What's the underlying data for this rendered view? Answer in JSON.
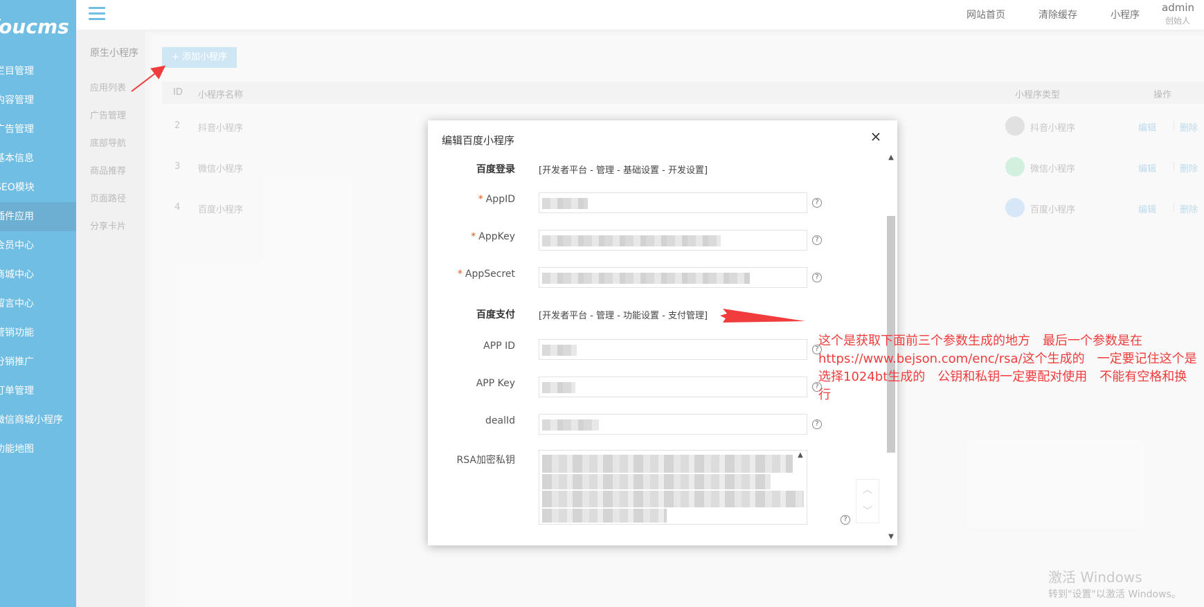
{
  "brand": {
    "logo_text": "foucms"
  },
  "sidebar": {
    "items": [
      {
        "label": "栏目管理"
      },
      {
        "label": "内容管理"
      },
      {
        "label": "广告管理"
      },
      {
        "label": "基本信息"
      },
      {
        "label": "SEO模块"
      },
      {
        "label": "插件应用",
        "active": true
      },
      {
        "label": "会员中心"
      },
      {
        "label": "商城中心"
      },
      {
        "label": "留言中心"
      },
      {
        "label": "营销功能"
      },
      {
        "label": "分销推广"
      },
      {
        "label": "订单管理"
      },
      {
        "label": "微信商城小程序"
      },
      {
        "label": "功能地图"
      }
    ]
  },
  "header": {
    "links": [
      "网站首页",
      "清除缓存",
      "小程序"
    ],
    "user_name": "admin",
    "user_role": "创始人"
  },
  "subnav": {
    "title": "原生小程序",
    "items": [
      "应用列表",
      "广告管理",
      "底部导航",
      "商品推荐",
      "页面路径",
      "分享卡片"
    ]
  },
  "main": {
    "add_button": "+ 添加小程序",
    "columns": {
      "id": "ID",
      "name": "小程序名称",
      "type": "小程序类型",
      "action": "操作"
    },
    "rows": [
      {
        "id": "2",
        "name": "抖音小程序",
        "type": "抖音小程序",
        "edit": "编辑",
        "delete": "删除"
      },
      {
        "id": "3",
        "name": "微信小程序",
        "type": "微信小程序",
        "edit": "编辑",
        "delete": "删除"
      },
      {
        "id": "4",
        "name": "百度小程序",
        "type": "百度小程序",
        "edit": "编辑",
        "delete": "删除"
      }
    ]
  },
  "modal": {
    "title": "编辑百度小程序",
    "close": "×",
    "login_label": "百度登录",
    "login_note": "[开发者平台 - 管理 - 基础设置 - 开发设置]",
    "appid_label": "AppID",
    "appkey_label": "AppKey",
    "appsecret_label": "AppSecret",
    "pay_label": "百度支付",
    "pay_note": "[开发者平台 - 管理 - 功能设置 - 支付管理]",
    "pay_appid_label": "APP ID",
    "pay_appkey_label": "APP Key",
    "dealid_label": "dealId",
    "rsa_label": "RSA加密私钥",
    "required_mark": "*",
    "help_mark": "?"
  },
  "annotation": {
    "text": "这个是获取下面前三个参数生成的地方　最后一个参数是在https://www.bejson.com/enc/rsa/这个生成的　一定要记住这个是选择1024bt生成的　公钥和私钥一定要配对使用　不能有空格和换行"
  },
  "watermark": {
    "line1": "激活 Windows",
    "line2": "转到\"设置\"以激活 Windows。"
  },
  "colors": {
    "sidebar": "#2f9fd8",
    "sidebar_active": "#2789bf",
    "annotation": "#f03c3c",
    "required": "#e0581b"
  }
}
